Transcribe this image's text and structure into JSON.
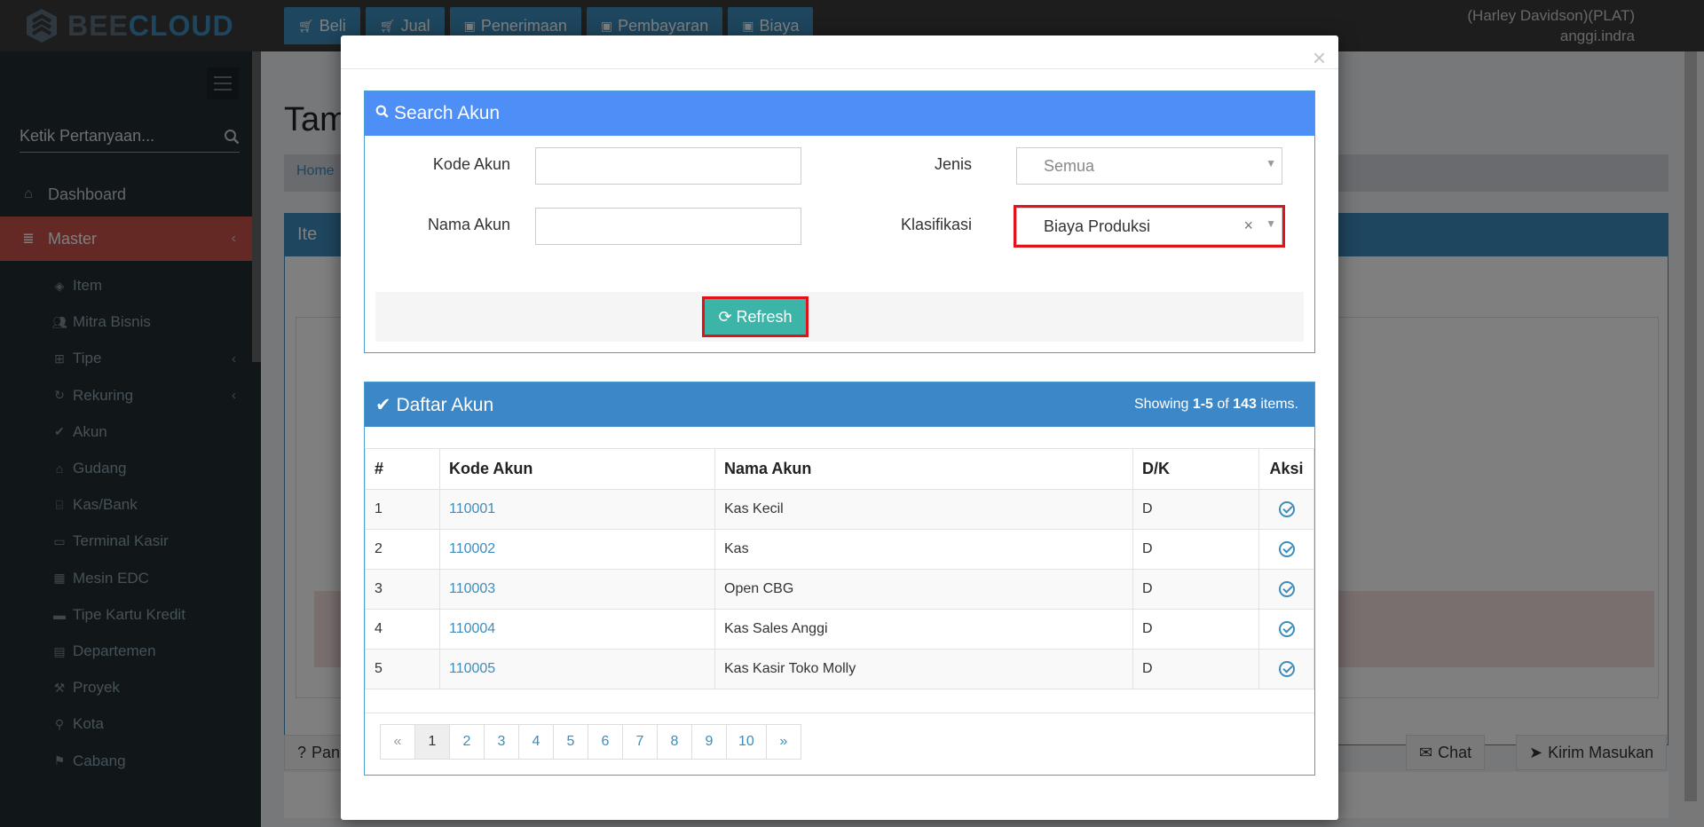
{
  "app": {
    "logo_bee": "BEE",
    "logo_cloud": "CLOUD"
  },
  "topnav": [
    {
      "label": "Beli",
      "icon": "cart-icon"
    },
    {
      "label": "Jual",
      "icon": "cart-icon"
    },
    {
      "label": "Penerimaan",
      "icon": "money-icon"
    },
    {
      "label": "Pembayaran",
      "icon": "money-icon"
    },
    {
      "label": "Biaya",
      "icon": "money-icon"
    }
  ],
  "user": {
    "company": "(Harley Davidson)(PLAT)",
    "name": "anggi.indra"
  },
  "sidebar": {
    "search_placeholder": "Ketik Pertanyaan...",
    "items": [
      {
        "label": "Dashboard",
        "icon": "home-icon"
      },
      {
        "label": "Master",
        "icon": "database-icon",
        "active": true
      }
    ],
    "sub": [
      {
        "label": "Item",
        "icon": "cube-icon"
      },
      {
        "label": "Mitra Bisnis",
        "icon": "users-icon"
      },
      {
        "label": "Tipe",
        "icon": "sitemap-icon"
      },
      {
        "label": "Rekuring",
        "icon": "refresh-icon"
      },
      {
        "label": "Akun",
        "icon": "check-icon"
      },
      {
        "label": "Gudang",
        "icon": "home-icon"
      },
      {
        "label": "Kas/Bank",
        "icon": "bank-icon"
      },
      {
        "label": "Terminal Kasir",
        "icon": "monitor-icon"
      },
      {
        "label": "Mesin EDC",
        "icon": "calculator-icon"
      },
      {
        "label": "Tipe Kartu Kredit",
        "icon": "credit-card-icon"
      },
      {
        "label": "Departemen",
        "icon": "clipboard-icon"
      },
      {
        "label": "Proyek",
        "icon": "gavel-icon"
      },
      {
        "label": "Kota",
        "icon": "map-marker-icon"
      },
      {
        "label": "Cabang",
        "icon": "branch-icon"
      }
    ]
  },
  "background": {
    "title": "Tam",
    "breadcrumb": "Home",
    "panel_title": "Ite",
    "help_label": "Pan",
    "chat_label": "Chat",
    "feedback_label": "Kirim Masukan"
  },
  "modal": {
    "search": {
      "title": "Search Akun",
      "kode_label": "Kode Akun",
      "nama_label": "Nama Akun",
      "jenis_label": "Jenis",
      "jenis_value": "Semua",
      "klasifikasi_label": "Klasifikasi",
      "klasifikasi_value": "Biaya Produksi",
      "refresh_label": "Refresh"
    },
    "list": {
      "title": "Daftar Akun",
      "showing_prefix": "Showing ",
      "showing_range": "1-5",
      "showing_of": " of ",
      "showing_total": "143",
      "showing_suffix": " items.",
      "columns": [
        "#",
        "Kode Akun",
        "Nama Akun",
        "D/K",
        "Aksi"
      ],
      "rows": [
        {
          "no": "1",
          "kode": "110001",
          "nama": "Kas Kecil",
          "dk": "D"
        },
        {
          "no": "2",
          "kode": "110002",
          "nama": "Kas",
          "dk": "D"
        },
        {
          "no": "3",
          "kode": "110003",
          "nama": "Open CBG",
          "dk": "D"
        },
        {
          "no": "4",
          "kode": "110004",
          "nama": "Kas Sales Anggi",
          "dk": "D"
        },
        {
          "no": "5",
          "kode": "110005",
          "nama": "Kas Kasir Toko Molly",
          "dk": "D"
        }
      ],
      "pager": [
        "«",
        "1",
        "2",
        "3",
        "4",
        "5",
        "6",
        "7",
        "8",
        "9",
        "10",
        "»"
      ],
      "pager_active": "1"
    }
  },
  "colors": {
    "primary": "#3c8dbc",
    "search_head": "#4e8ef7",
    "active_menu": "#c9504a",
    "refresh": "#3cb4a8",
    "highlight": "#e0131b"
  }
}
